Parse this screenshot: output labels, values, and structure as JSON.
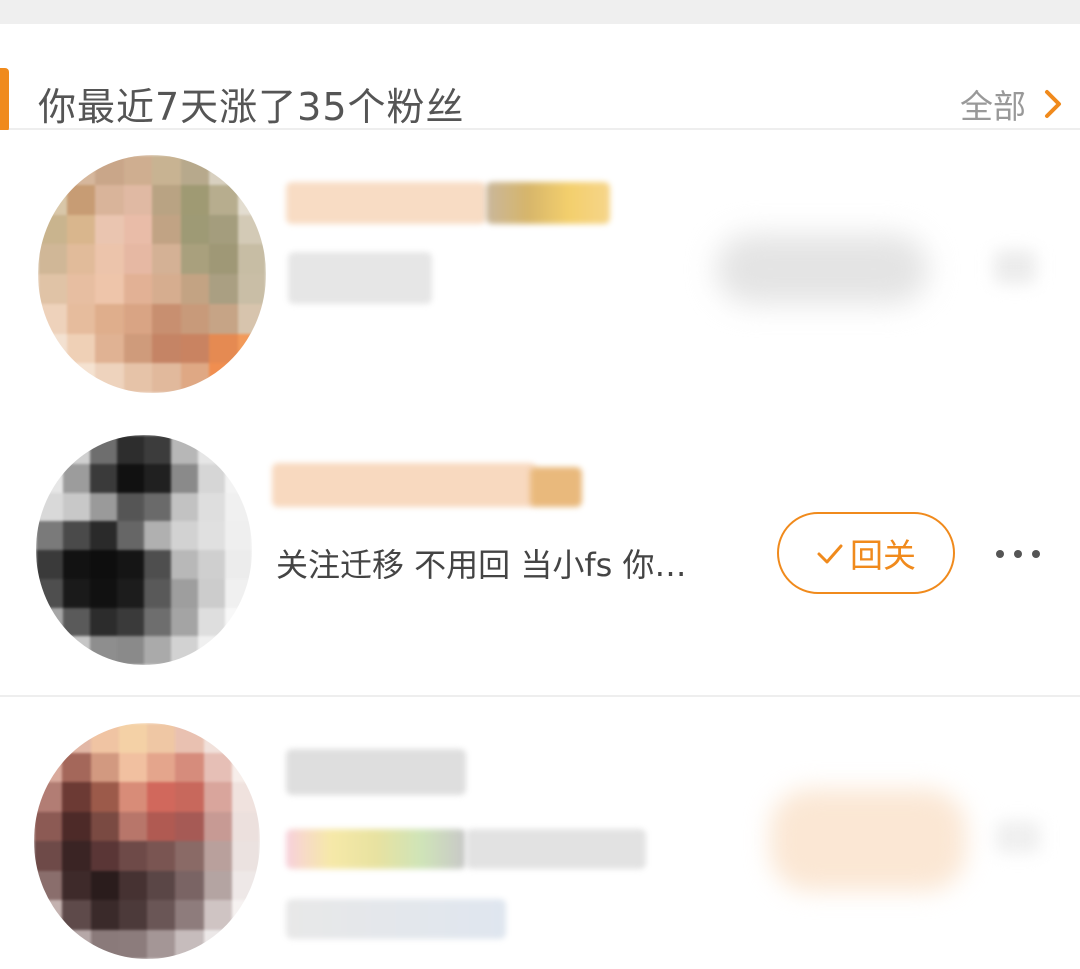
{
  "header": {
    "title": "你最近7天涨了35个粉丝",
    "all_label": "全部",
    "accent_color": "#f08a1c",
    "chevron_icon": "chevron-right-icon"
  },
  "fans": [
    {
      "name": "",
      "description": "",
      "action_label": ""
    },
    {
      "name": "",
      "description": "关注迁移 不用回 当小fs 你…",
      "action_label": "回关",
      "action_icon": "check-icon",
      "more_icon": "more-dots-icon"
    },
    {
      "name": "",
      "description": "",
      "action_label": ""
    }
  ]
}
